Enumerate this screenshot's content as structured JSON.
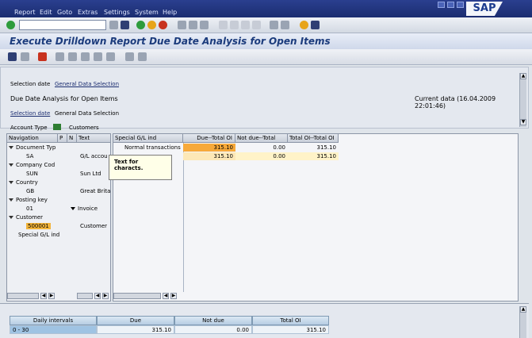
{
  "menu": [
    "Report",
    "Edit",
    "Goto",
    "Extras",
    "Settings",
    "System",
    "Help"
  ],
  "brand": "SAP",
  "window_title": "Execute Drilldown Report Due Date Analysis for Open Items",
  "header": {
    "selection_date_label": "Selection date",
    "general_data_selection_link": "General Data Selection",
    "report_name": "Due Date Analysis for Open Items",
    "current_data": "Current data (16.04.2009 22:01:46)",
    "selection_date_link": "Selection date",
    "general_data_selection_label": "General Data Selection",
    "account_type_label": "Account Type",
    "account_type_value": "Customers"
  },
  "navigation": {
    "headers": [
      "Navigation",
      "P",
      "N",
      "Text"
    ],
    "rows": [
      {
        "label": "Document Typ",
        "text": ""
      },
      {
        "label": "SA",
        "text": "G/L accou"
      },
      {
        "label": "Company Cod",
        "text": ""
      },
      {
        "label": "SUN",
        "text": "Sun Ltd"
      },
      {
        "label": "Country",
        "text": ""
      },
      {
        "label": "GB",
        "text": "Great Brita"
      },
      {
        "label": "Posting key",
        "text": ""
      },
      {
        "label": "01",
        "text": "Invoice"
      },
      {
        "label": "Customer",
        "text": ""
      },
      {
        "label": "500001",
        "text": "Customer"
      },
      {
        "label": "Special G/L ind",
        "text": ""
      }
    ]
  },
  "results": {
    "headers": [
      "Special G/L ind",
      "Due--Total OI",
      "Not due--Total",
      "Total OI--Total OI"
    ],
    "rows": [
      {
        "label": "Normal transactions",
        "due": "315.10",
        "not_due": "0.00",
        "total": "315.10"
      },
      {
        "label": "",
        "due": "315.10",
        "not_due": "0.00",
        "total": "315.10"
      }
    ]
  },
  "tooltip": "Text for characts.",
  "bottom_table": {
    "headers": [
      "Daily intervals",
      "Due",
      "Not due",
      "Total OI"
    ],
    "rows": [
      {
        "interval": "0 - 30",
        "due": "315.10",
        "not_due": "0.00",
        "total": "315.10"
      }
    ]
  }
}
